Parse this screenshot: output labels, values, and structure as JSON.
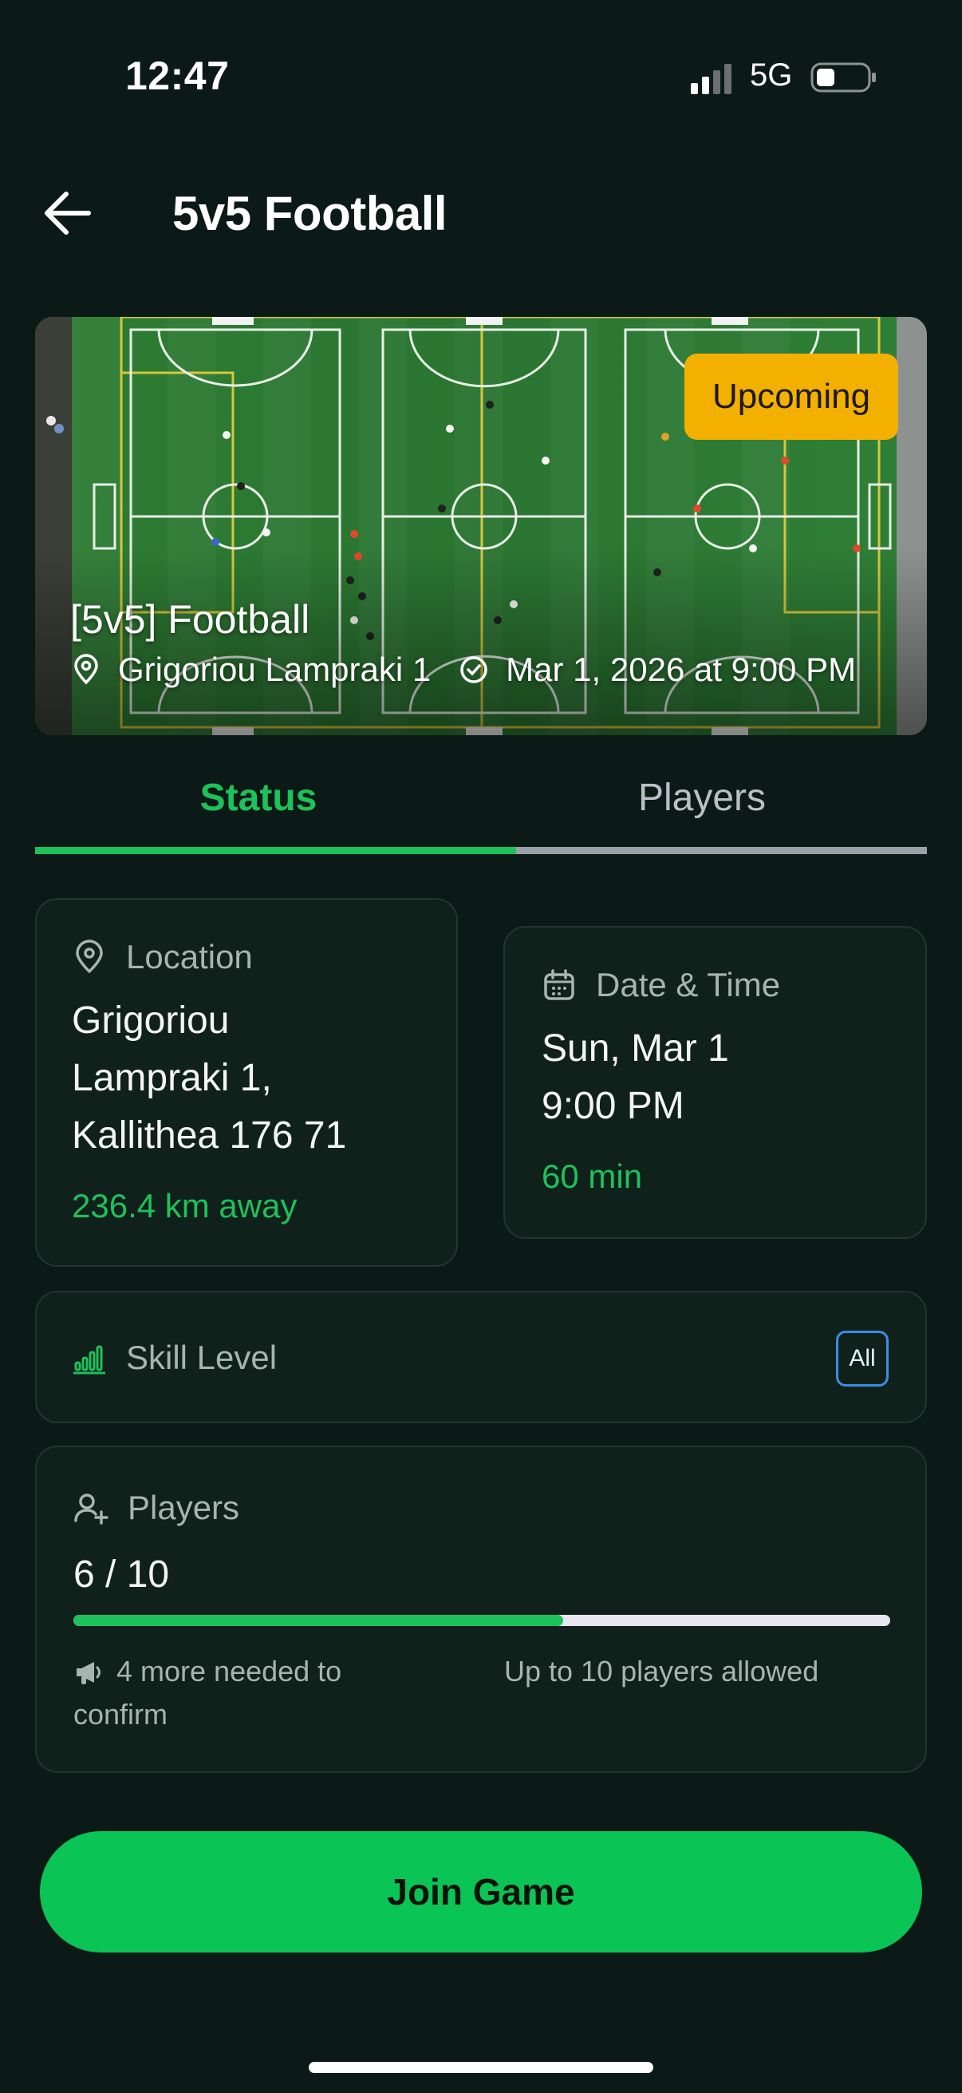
{
  "status_bar": {
    "time": "12:47",
    "network": "5G"
  },
  "header": {
    "title": "5v5 Football"
  },
  "hero": {
    "badge": "Upcoming",
    "title": "[5v5] Football",
    "location": "Grigoriou Lampraki 1",
    "datetime": "Mar 1, 2026 at 9:00 PM"
  },
  "tabs": [
    {
      "label": "Status",
      "active": true
    },
    {
      "label": "Players",
      "active": false
    }
  ],
  "location_card": {
    "label": "Location",
    "line1": "Grigoriou",
    "line2": "Lampraki 1,",
    "line3": "Kallithea 176 71",
    "distance": "236.4 km away"
  },
  "datetime_card": {
    "label": "Date & Time",
    "date": "Sun, Mar 1",
    "time": "9:00 PM",
    "duration": "60 min"
  },
  "skill_card": {
    "label": "Skill Level",
    "level": "All"
  },
  "players_card": {
    "label": "Players",
    "count": "6 / 10",
    "joined": 6,
    "max": 10,
    "needed_line1": "4 more needed to",
    "needed_line2": "confirm",
    "allowed": "Up to 10 players allowed"
  },
  "actions": {
    "join_label": "Join Game"
  },
  "colors": {
    "background": "#0b1a16",
    "accent": "#1ec15a",
    "badge": "#f4b000",
    "card": "#10201b"
  },
  "icons": [
    "back-arrow-icon",
    "signal-icon",
    "battery-icon",
    "map-pin-icon",
    "clock-icon",
    "calendar-icon",
    "skill-bars-icon",
    "user-plus-icon",
    "megaphone-icon"
  ]
}
